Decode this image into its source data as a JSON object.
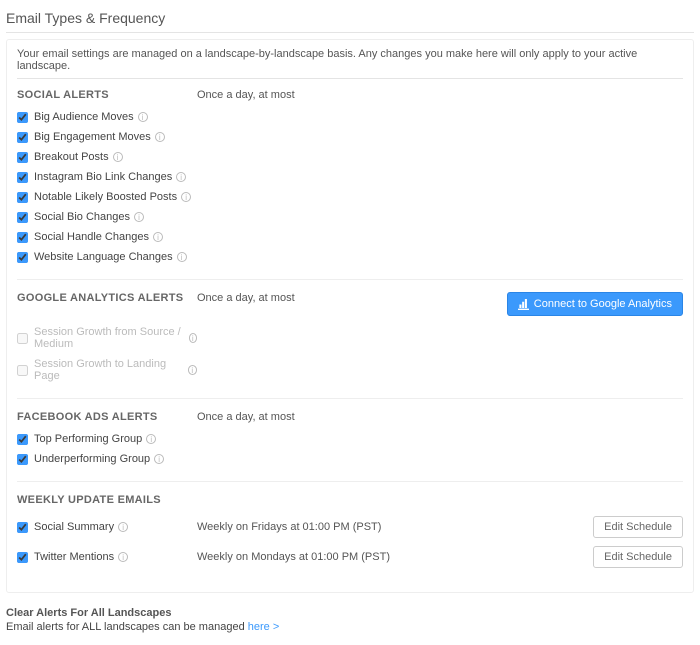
{
  "page": {
    "title": "Email Types & Frequency",
    "description": "Your email settings are managed on a landscape-by-landscape basis. Any changes you make here will only apply to your active landscape."
  },
  "connect_button": "Connect to Google Analytics",
  "edit_schedule_label": "Edit Schedule",
  "sections": {
    "social": {
      "title": "SOCIAL ALERTS",
      "frequency": "Once a day, at most",
      "items": [
        {
          "label": "Big Audience Moves",
          "checked": true
        },
        {
          "label": "Big Engagement Moves",
          "checked": true
        },
        {
          "label": "Breakout Posts",
          "checked": true
        },
        {
          "label": "Instagram Bio Link Changes",
          "checked": true
        },
        {
          "label": "Notable Likely Boosted Posts",
          "checked": true
        },
        {
          "label": "Social Bio Changes",
          "checked": true
        },
        {
          "label": "Social Handle Changes",
          "checked": true
        },
        {
          "label": "Website Language Changes",
          "checked": true
        }
      ]
    },
    "ga": {
      "title": "GOOGLE ANALYTICS ALERTS",
      "frequency": "Once a day, at most",
      "items": [
        {
          "label": "Session Growth from Source / Medium",
          "checked": false,
          "disabled": true
        },
        {
          "label": "Session Growth to Landing Page",
          "checked": false,
          "disabled": true
        }
      ]
    },
    "fb": {
      "title": "FACEBOOK ADS ALERTS",
      "frequency": "Once a day, at most",
      "items": [
        {
          "label": "Top Performing Group",
          "checked": true
        },
        {
          "label": "Underperforming Group",
          "checked": true
        }
      ]
    },
    "weekly": {
      "title": "WEEKLY UPDATE EMAILS",
      "items": [
        {
          "label": "Social Summary",
          "checked": true,
          "schedule": "Weekly on Fridays at 01:00 PM (PST)"
        },
        {
          "label": "Twitter Mentions",
          "checked": true,
          "schedule": "Weekly on Mondays at 01:00 PM (PST)"
        }
      ]
    }
  },
  "footer": {
    "title": "Clear Alerts For All Landscapes",
    "text": "Email alerts for ALL landscapes can be managed ",
    "link": "here >"
  }
}
